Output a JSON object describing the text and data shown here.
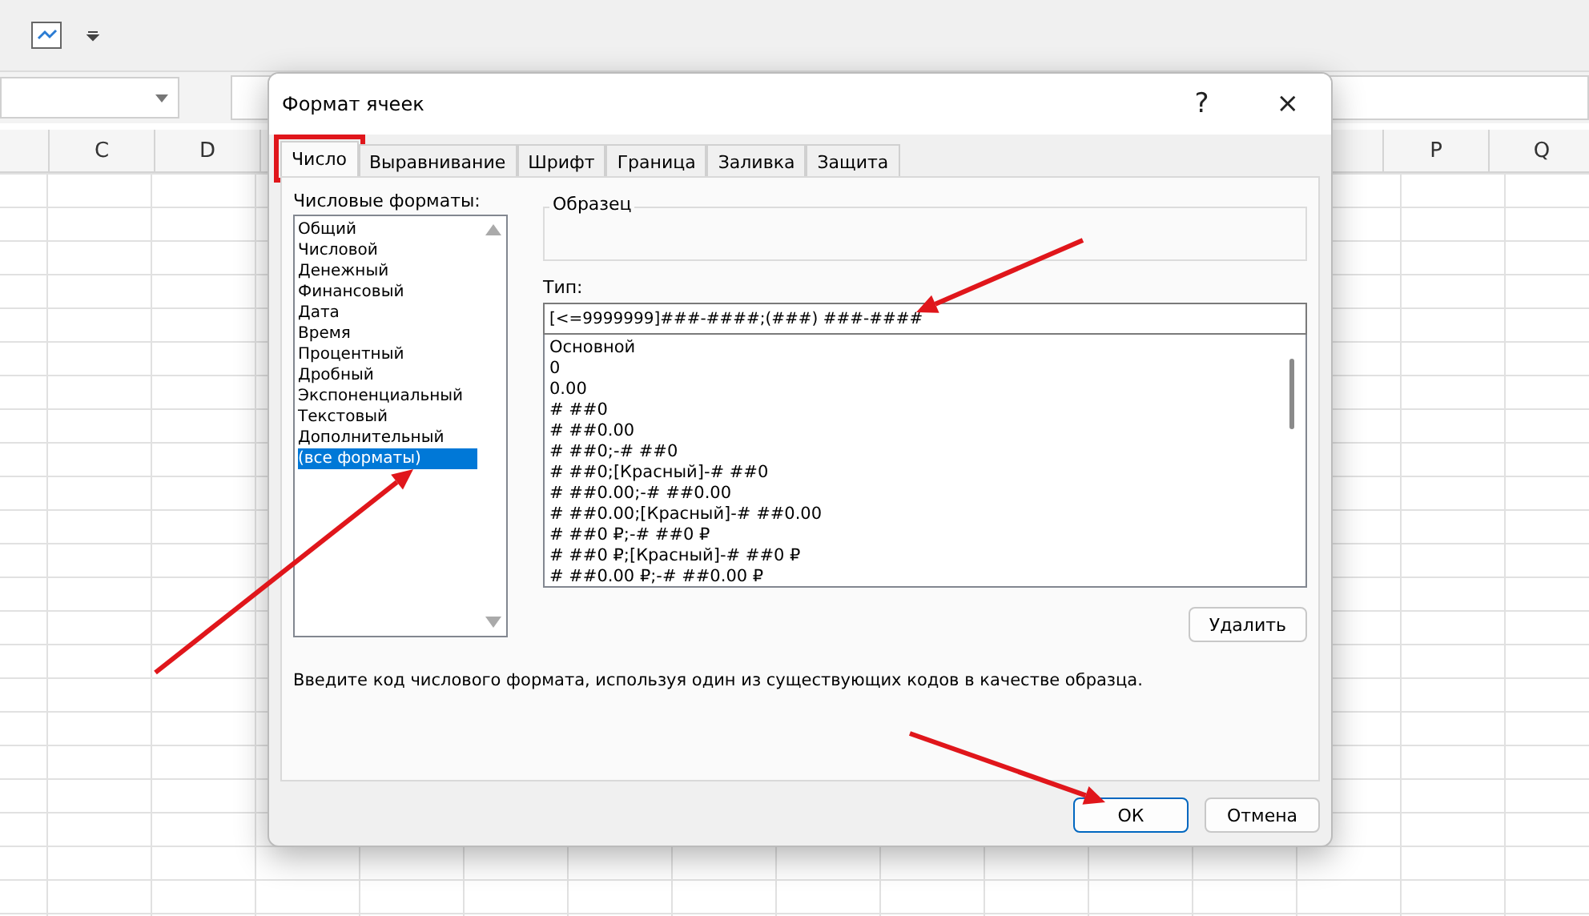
{
  "spreadsheet": {
    "columns_left": [
      "C",
      "D"
    ],
    "columns_right": [
      "P",
      "Q"
    ]
  },
  "dialog": {
    "title": "Формат ячеек",
    "help": "?",
    "close": "×",
    "tabs": [
      {
        "label": "Число",
        "selected": true,
        "highlighted": true
      },
      {
        "label": "Выравнивание",
        "selected": false,
        "highlighted": false
      },
      {
        "label": "Шрифт",
        "selected": false,
        "highlighted": false
      },
      {
        "label": "Граница",
        "selected": false,
        "highlighted": false
      },
      {
        "label": "Заливка",
        "selected": false,
        "highlighted": false
      },
      {
        "label": "Защита",
        "selected": false,
        "highlighted": false
      }
    ],
    "categories_label": "Числовые форматы:",
    "categories": [
      {
        "label": "Общий",
        "selected": false
      },
      {
        "label": "Числовой",
        "selected": false
      },
      {
        "label": "Денежный",
        "selected": false
      },
      {
        "label": "Финансовый",
        "selected": false
      },
      {
        "label": "Дата",
        "selected": false
      },
      {
        "label": "Время",
        "selected": false
      },
      {
        "label": "Процентный",
        "selected": false
      },
      {
        "label": "Дробный",
        "selected": false
      },
      {
        "label": "Экспоненциальный",
        "selected": false
      },
      {
        "label": "Текстовый",
        "selected": false
      },
      {
        "label": "Дополнительный",
        "selected": false
      },
      {
        "label": "(все форматы)",
        "selected": true
      }
    ],
    "sample_label": "Образец",
    "type_label": "Тип:",
    "type_value": "[<=9999999]###-####;(###) ###-####",
    "formats": [
      "Основной",
      "0",
      "0.00",
      "# ##0",
      "# ##0.00",
      "# ##0;-# ##0",
      "# ##0;[Красный]-# ##0",
      "# ##0.00;-# ##0.00",
      "# ##0.00;[Красный]-# ##0.00",
      "# ##0 ₽;-# ##0 ₽",
      "# ##0 ₽;[Красный]-# ##0 ₽",
      "# ##0.00 ₽;-# ##0.00 ₽"
    ],
    "delete_button": "Удалить",
    "description": "Введите код числового формата, используя один из существующих кодов в качестве образца.",
    "buttons": [
      {
        "label": "ОК",
        "default": true
      },
      {
        "label": "Отмена",
        "default": false
      }
    ]
  }
}
